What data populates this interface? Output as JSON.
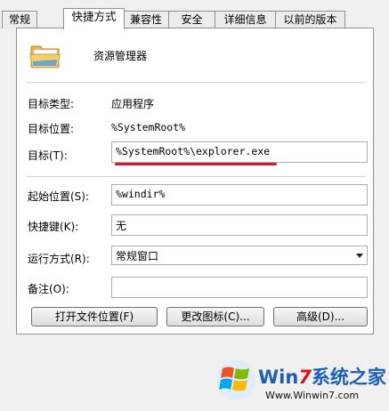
{
  "tabs": [
    "常规",
    "快捷方式",
    "兼容性",
    "安全",
    "详细信息",
    "以前的版本"
  ],
  "active_tab": "快捷方式",
  "app_name": "资源管理器",
  "fields": {
    "target_type": {
      "label": "目标类型:",
      "value": "应用程序"
    },
    "target_location": {
      "label": "目标位置:",
      "value": "%SystemRoot%"
    },
    "target": {
      "label": "目标(T):",
      "value": "%SystemRoot%\\explorer.exe"
    },
    "start_in": {
      "label": "起始位置(S):",
      "value": "%windir%"
    },
    "shortcut_key": {
      "label": "快捷键(K):",
      "value": "无"
    },
    "run": {
      "label": "运行方式(R):",
      "value": "常规窗口"
    },
    "comment": {
      "label": "备注(O):",
      "value": ""
    }
  },
  "buttons": {
    "open_location": "打开文件位置(F)",
    "change_icon": "更改图标(C)...",
    "advanced": "高级(D)..."
  },
  "watermark": {
    "brand_win": "Win",
    "brand_7": "7",
    "brand_cn": "系统之家",
    "url": "Www.Winwin7.com"
  },
  "colors": {
    "target_underline": "#d0182e",
    "brand_blue": "#1b5fb8",
    "brand_red": "#e01010"
  }
}
